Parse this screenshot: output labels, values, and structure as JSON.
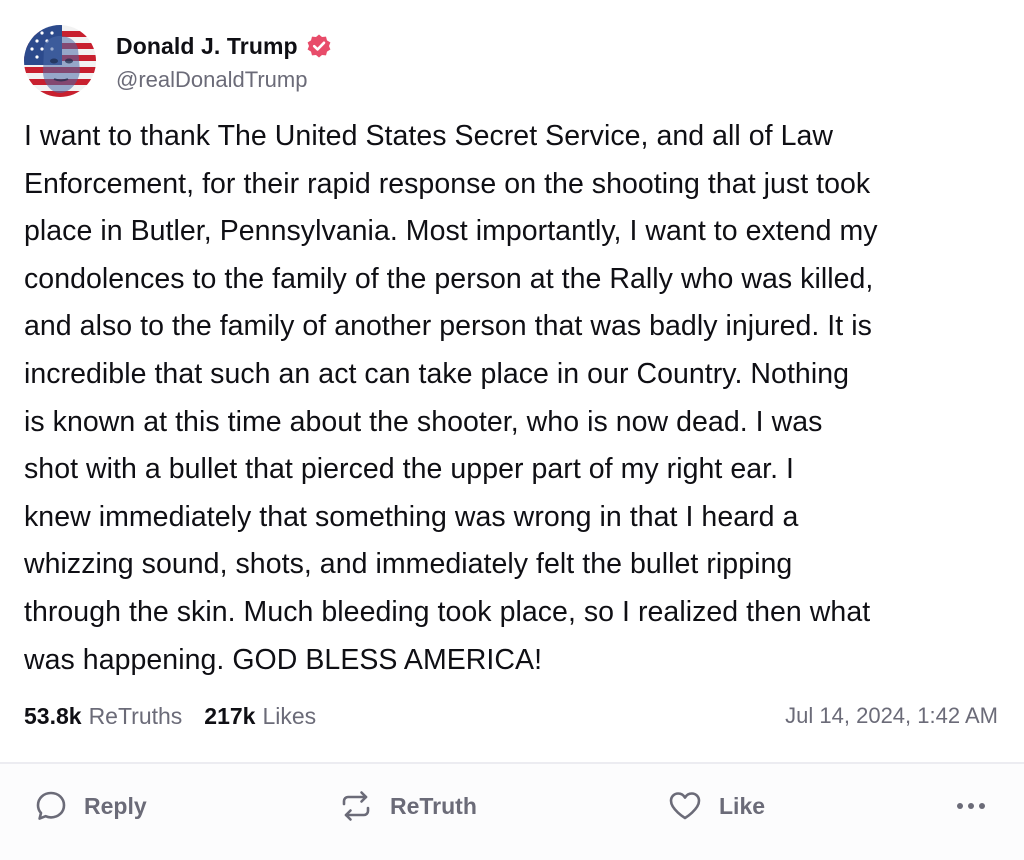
{
  "author": {
    "display_name": "Donald J. Trump",
    "handle": "@realDonaldTrump",
    "verified": true,
    "verified_badge_icon": "verified-badge-icon",
    "badge_color": "#e84c6a"
  },
  "post": {
    "lines": [
      "I want to thank The United States Secret Service, and all of Law",
      "Enforcement, for their rapid response on the shooting that just took",
      "place in Butler, Pennsylvania. Most importantly, I want to extend my",
      "condolences to the family of the person at the Rally who was killed,",
      "and also to the family of another person that was badly injured. It is",
      "incredible that such an act can take place in our Country. Nothing",
      "is known at this time about the shooter, who is now dead. I was",
      "shot with a bullet that pierced the upper part of my right ear. I",
      "knew immediately that something was wrong in that I heard a",
      "whizzing sound, shots, and immediately felt the bullet ripping",
      "through the skin. Much bleeding took place, so I realized then what",
      "was happening. GOD BLESS AMERICA!"
    ]
  },
  "stats": {
    "retruths_count": "53.8k",
    "retruths_label": "ReTruths",
    "likes_count": "217k",
    "likes_label": "Likes"
  },
  "timestamp": "Jul 14, 2024, 1:42 AM",
  "actions": {
    "reply_label": "Reply",
    "retruth_label": "ReTruth",
    "like_label": "Like",
    "reply_icon": "speech-bubble-icon",
    "retruth_icon": "repost-arrows-icon",
    "like_icon": "heart-icon",
    "more_icon": "more-dots-icon"
  },
  "colors": {
    "text_primary": "#0f0f14",
    "text_secondary": "#6b6b78",
    "divider": "#ececf1"
  }
}
